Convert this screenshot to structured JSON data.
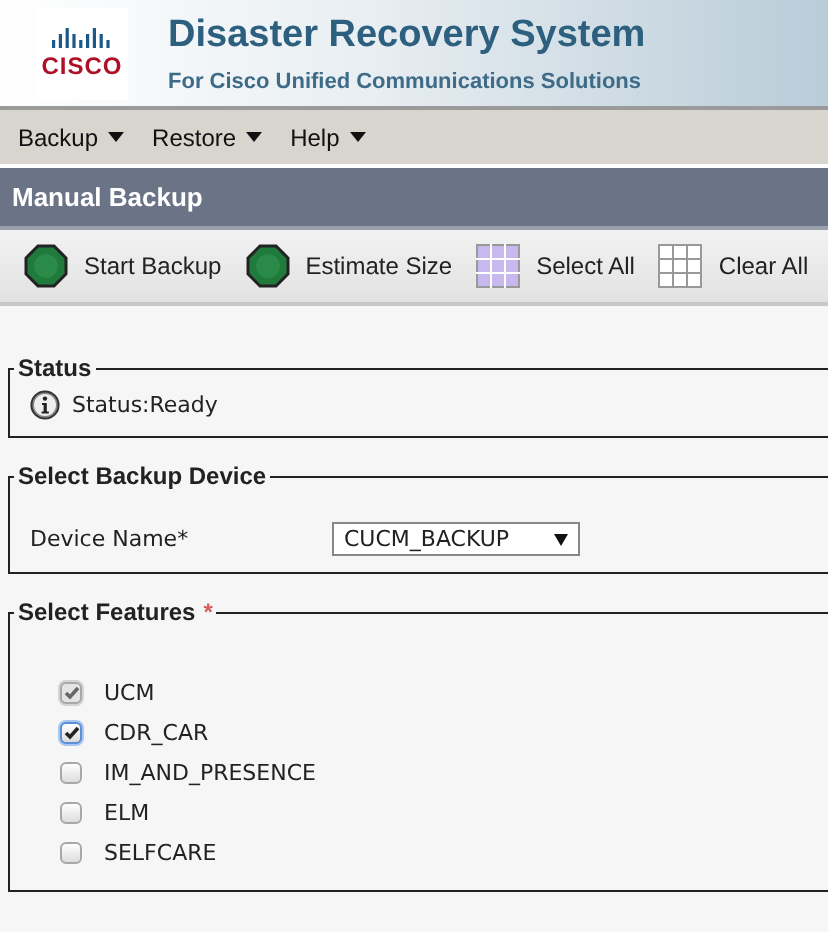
{
  "header": {
    "logo_text": "CISCO",
    "title": "Disaster Recovery System",
    "subtitle": "For Cisco Unified Communications Solutions"
  },
  "menu": [
    {
      "label": "Backup"
    },
    {
      "label": "Restore"
    },
    {
      "label": "Help"
    }
  ],
  "page_title": "Manual Backup",
  "toolbar": [
    {
      "kind": "start",
      "label": "Start Backup"
    },
    {
      "kind": "start",
      "label": "Estimate Size"
    },
    {
      "kind": "select_all",
      "label": "Select All"
    },
    {
      "kind": "clear_all",
      "label": "Clear All"
    }
  ],
  "status": {
    "legend": "Status",
    "text": "Status:Ready"
  },
  "device": {
    "legend": "Select Backup Device",
    "label": "Device Name*",
    "value": "CUCM_BACKUP"
  },
  "features": {
    "legend": "Select Features",
    "required_mark": "*",
    "items": [
      {
        "label": "UCM",
        "checked": true,
        "disabled": true,
        "focused": false
      },
      {
        "label": "CDR_CAR",
        "checked": true,
        "disabled": false,
        "focused": true
      },
      {
        "label": "IM_AND_PRESENCE",
        "checked": false,
        "disabled": false,
        "focused": false
      },
      {
        "label": "ELM",
        "checked": false,
        "disabled": false,
        "focused": false
      },
      {
        "label": "SELFCARE",
        "checked": false,
        "disabled": false,
        "focused": false
      }
    ]
  }
}
